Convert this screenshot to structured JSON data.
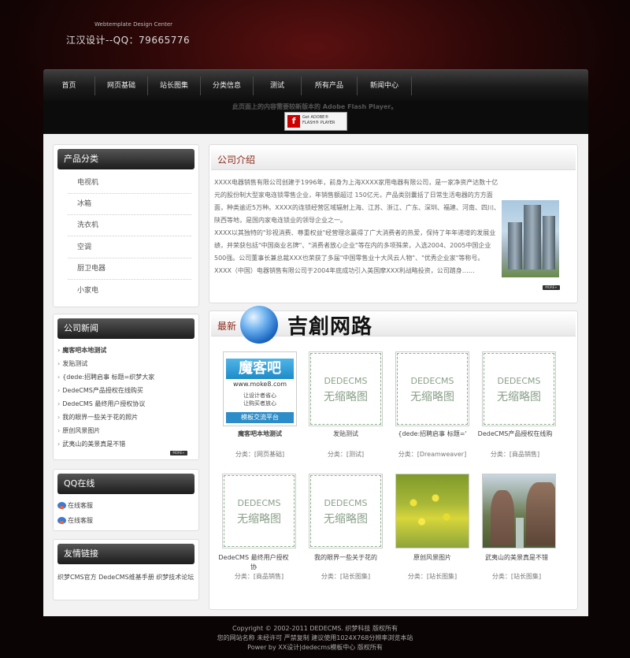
{
  "header": {
    "subtitle": "Webtemplate Design Center",
    "title": "江汉设计--QQ：79665776"
  },
  "nav": {
    "items": [
      "首页",
      "网页基础",
      "站长图集",
      "分类信息",
      "测试",
      "所有产品",
      "新闻中心"
    ]
  },
  "flash": {
    "notice": "此页面上的内容需要较新版本的 Adobe Flash Player。",
    "button_line1": "Get ADOBE®",
    "button_line2": "FLASH® PLAYER"
  },
  "sidebar": {
    "categories": {
      "title": "产品分类",
      "items": [
        "电视机",
        "冰箱",
        "洗衣机",
        "空调",
        "厨卫电器",
        "小家电"
      ]
    },
    "news": {
      "title": "公司新闻",
      "items": [
        "魔客吧本地测试",
        "发贴测试",
        "{dede:招聘启事 标题=织梦大家",
        "DedeCMS产品授权在线购买",
        "DedeCMS 最终用户授权协议",
        "我的眼界一些关于花的照片",
        "原创风景图片",
        "武夷山的美景真是不错"
      ],
      "more": "MORE+"
    },
    "qq": {
      "title": "QQ在线",
      "items": [
        "在线客服",
        "在线客服"
      ]
    },
    "links": {
      "title": "友情链接",
      "text": "织梦CMS官方 DedeCMS维基手册 织梦技术论坛"
    }
  },
  "about": {
    "title": "公司介绍",
    "paragraphs": [
      "XXXX电器销售有限公司创建于1996年，前身为上海XXXX家用电器有限公司，是一家净资产达数十亿元的股份制大型家电连锁零售企业，年销售额超过 150亿元，产品类别囊括了日常生活电器的方方面面，种类逾近5万种。XXXX的连锁经营区域辐射上海、江苏、浙江、广东、深圳、福建、河南、四川、陕西等地，是国内家电连锁业的领导企业之一。",
      "XXXX以其独特的\"珍视消费、尊重权益\"经营理念赢得了广大消费者的热爱，保持了年年递增的发展业绩，并荣获包括\"中国商业名牌\"、\"消费者放心企业\"等在内的多项殊荣，入选2004、2005中国企业500强。公司董事长兼总裁XXX也荣获了多届\"中国零售业十大风云人物\"、\"优秀企业家\"等称号。",
      "XXXX（中国）电器销售有限公司于2004年底成功引入美国摩XXX利战略投资，公司踏身……"
    ],
    "more": "MORE+"
  },
  "products": {
    "title": "最新",
    "watermark": "吉創网路",
    "placeholder_line1": "DEDECMS",
    "placeholder_line2": "无缩略图",
    "moke": {
      "brand": "魔客吧",
      "url": "www.moke8.com",
      "slogan1": "让设计者省心",
      "slogan2": "让购买者放心",
      "bar": "模板交流平台"
    },
    "items": [
      {
        "title": "魔客吧本地测试",
        "cat": "分类：[网页基础]"
      },
      {
        "title": "发贴测试",
        "cat": "分类：[测试]"
      },
      {
        "title": "{dede:招聘启事 标题='",
        "cat": "分类：[Dreamweaver]"
      },
      {
        "title": "DedeCMS产品授权在线购",
        "cat": "分类：[商品销售]"
      },
      {
        "title": "DedeCMS 最终用户授权协",
        "cat": "分类：[商品销售]"
      },
      {
        "title": "我的眼界一些关于花的",
        "cat": "分类：[站长图集]"
      },
      {
        "title": "原创风景图片",
        "cat": "分类：[站长图集]"
      },
      {
        "title": "武夷山的美景真是不错",
        "cat": "分类：[站长图集]"
      }
    ]
  },
  "footer": {
    "line1": "Copyright © 2002-2011 DEDECMS. 织梦科技 版权所有",
    "line2": "您的网站名称 未经许可 严禁复制 建议使用1024X768分辨率浏览本站",
    "line3": "Power by XX设计|dedecms模板中心 版权所有"
  }
}
